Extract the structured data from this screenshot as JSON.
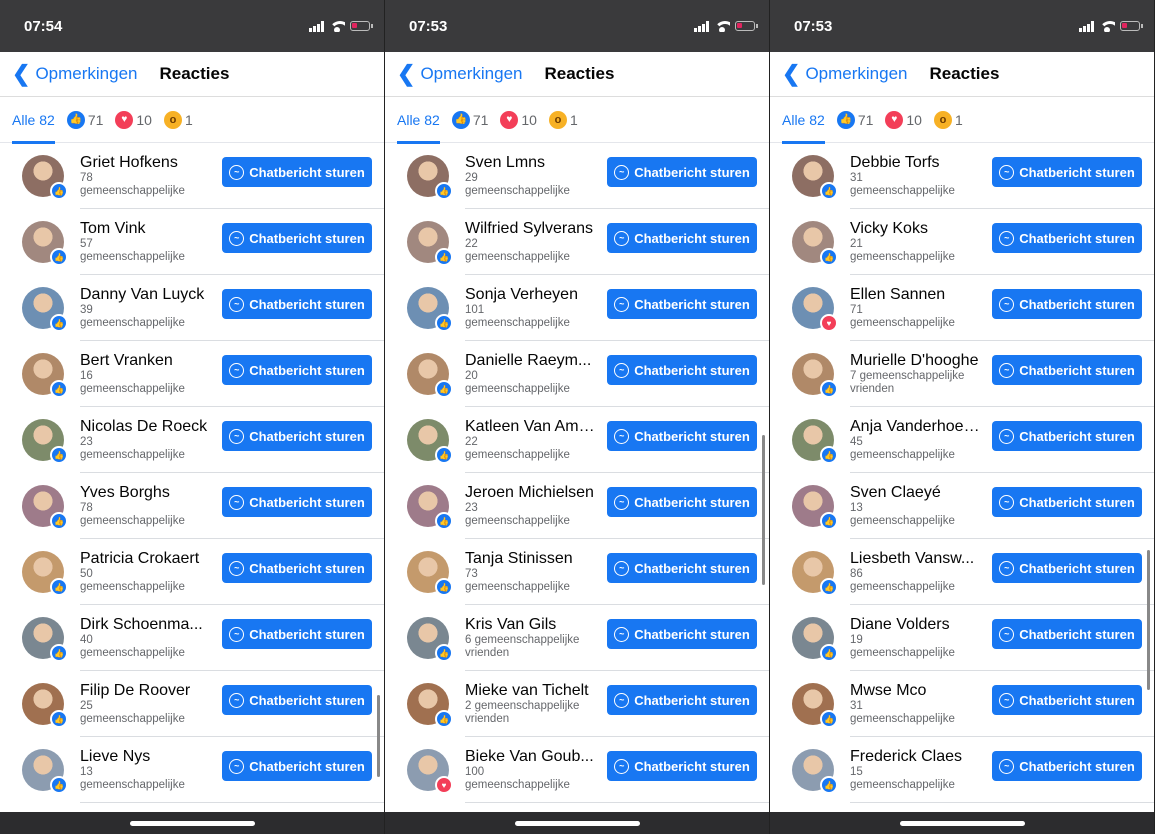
{
  "screens": [
    {
      "time": "07:54",
      "nav": {
        "back_label": "Opmerkingen",
        "title": "Reacties"
      },
      "filters": {
        "all_label": "Alle 82",
        "like_count": "71",
        "love_count": "10",
        "wow_count": "1"
      },
      "button_label": "Chatbericht sturen",
      "rows": [
        {
          "name": "Griet Hofkens",
          "mutual_count": "78",
          "mutual_label": "gemeenschappelijke",
          "reaction": "like"
        },
        {
          "name": "Tom Vink",
          "mutual_count": "57",
          "mutual_label": "gemeenschappelijke",
          "reaction": "like"
        },
        {
          "name": "Danny Van Luyck",
          "mutual_count": "39",
          "mutual_label": "gemeenschappelijke",
          "reaction": "like"
        },
        {
          "name": "Bert Vranken",
          "mutual_count": "16",
          "mutual_label": "gemeenschappelijke",
          "reaction": "like"
        },
        {
          "name": "Nicolas De Roeck",
          "mutual_count": "23",
          "mutual_label": "gemeenschappelijke",
          "reaction": "like"
        },
        {
          "name": "Yves Borghs",
          "mutual_count": "78",
          "mutual_label": "gemeenschappelijke",
          "reaction": "like"
        },
        {
          "name": "Patricia Crokaert",
          "mutual_count": "50",
          "mutual_label": "gemeenschappelijke",
          "reaction": "like"
        },
        {
          "name": "Dirk Schoenma...",
          "mutual_count": "40",
          "mutual_label": "gemeenschappelijke",
          "reaction": "like"
        },
        {
          "name": "Filip De Roover",
          "mutual_count": "25",
          "mutual_label": "gemeenschappelijke",
          "reaction": "like"
        },
        {
          "name": "Lieve Nys",
          "mutual_count": "13",
          "mutual_label": "gemeenschappelijke",
          "reaction": "like"
        }
      ]
    },
    {
      "time": "07:53",
      "nav": {
        "back_label": "Opmerkingen",
        "title": "Reacties"
      },
      "filters": {
        "all_label": "Alle 82",
        "like_count": "71",
        "love_count": "10",
        "wow_count": "1"
      },
      "button_label": "Chatbericht sturen",
      "rows": [
        {
          "name": "Sven Lmns",
          "mutual_count": "29",
          "mutual_label": "gemeenschappelijke",
          "reaction": "like"
        },
        {
          "name": "Wilfried Sylverans",
          "mutual_count": "22",
          "mutual_label": "gemeenschappelijke",
          "reaction": "like"
        },
        {
          "name": "Sonja Verheyen",
          "mutual_count": "101",
          "mutual_label": "gemeenschappelijke",
          "reaction": "like"
        },
        {
          "name": "Danielle Raeym...",
          "mutual_count": "20",
          "mutual_label": "gemeenschappelijke",
          "reaction": "like"
        },
        {
          "name": "Katleen Van Ammel",
          "mutual_count": "22",
          "mutual_label": "gemeenschappelijke",
          "reaction": "like"
        },
        {
          "name": "Jeroen Michielsen",
          "mutual_count": "23",
          "mutual_label": "gemeenschappelijke",
          "reaction": "like"
        },
        {
          "name": "Tanja Stinissen",
          "mutual_count": "73",
          "mutual_label": "gemeenschappelijke",
          "reaction": "like"
        },
        {
          "name": "Kris Van Gils",
          "mutual_count": "6 gemeenschappelijke",
          "mutual_label": "vrienden",
          "reaction": "like"
        },
        {
          "name": "Mieke van Tichelt",
          "mutual_count": "2 gemeenschappelijke",
          "mutual_label": "vrienden",
          "reaction": "like"
        },
        {
          "name": "Bieke Van Goub...",
          "mutual_count": "100",
          "mutual_label": "gemeenschappelijke",
          "reaction": "love"
        }
      ]
    },
    {
      "time": "07:53",
      "nav": {
        "back_label": "Opmerkingen",
        "title": "Reacties"
      },
      "filters": {
        "all_label": "Alle 82",
        "like_count": "71",
        "love_count": "10",
        "wow_count": "1"
      },
      "button_label": "Chatbericht sturen",
      "rows": [
        {
          "name": "Debbie Torfs",
          "mutual_count": "31",
          "mutual_label": "gemeenschappelijke",
          "reaction": "like"
        },
        {
          "name": "Vicky Koks",
          "mutual_count": "21",
          "mutual_label": "gemeenschappelijke",
          "reaction": "like"
        },
        {
          "name": "Ellen Sannen",
          "mutual_count": "71",
          "mutual_label": "gemeenschappelijke",
          "reaction": "love"
        },
        {
          "name": "Murielle D'hooghe",
          "mutual_count": "7 gemeenschappelijke",
          "mutual_label": "vrienden",
          "reaction": "like"
        },
        {
          "name": "Anja Vanderhoeven",
          "mutual_count": "45",
          "mutual_label": "gemeenschappelijke",
          "reaction": "like"
        },
        {
          "name": "Sven Claeyé",
          "mutual_count": "13",
          "mutual_label": "gemeenschappelijke",
          "reaction": "like"
        },
        {
          "name": "Liesbeth Vansw...",
          "mutual_count": "86",
          "mutual_label": "gemeenschappelijke",
          "reaction": "like"
        },
        {
          "name": "Diane Volders",
          "mutual_count": "19",
          "mutual_label": "gemeenschappelijke",
          "reaction": "like"
        },
        {
          "name": "Mwse Mco",
          "mutual_count": "31",
          "mutual_label": "gemeenschappelijke",
          "reaction": "like"
        },
        {
          "name": "Frederick Claes",
          "mutual_count": "15",
          "mutual_label": "gemeenschappelijke",
          "reaction": "like"
        }
      ]
    }
  ],
  "colors": {
    "accent": "#1877f2",
    "love": "#f33e58",
    "wow": "#f7b125"
  }
}
